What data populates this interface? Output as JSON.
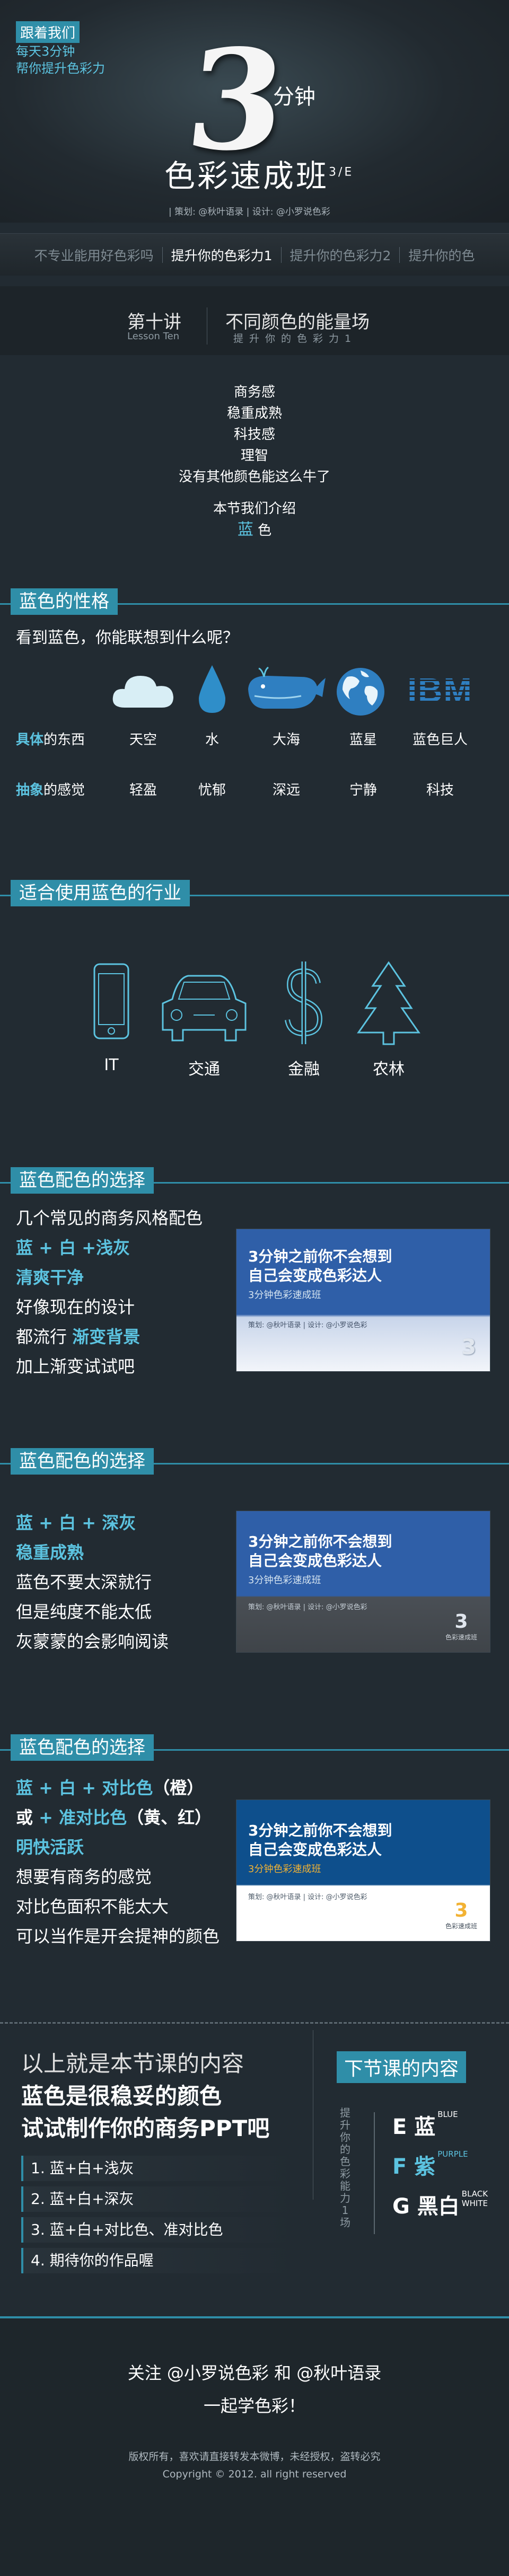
{
  "hero": {
    "follow": "跟着我们",
    "tag1": "每天3分钟",
    "tag2": "帮你提升色彩力",
    "big3": "3",
    "minute": "分钟",
    "title": "色彩速成班",
    "title_sup": "3/E",
    "credits": "| 策划: @秋叶语录    | 设计: @小罗说色彩"
  },
  "nav": {
    "items": [
      "不专业能用好色彩吗",
      "提升你的色彩力1",
      "提升你的色彩力2",
      "提升你的色"
    ],
    "active_index": 1
  },
  "lesson": {
    "cn": "第十讲",
    "en": "Lesson Ten",
    "topic": "不同颜色的能量场",
    "sub": "提升你的色彩力1"
  },
  "intro": {
    "lines": [
      "商务感",
      "稳重成熟",
      "科技感",
      "理智",
      "没有其他颜色能这么牛了"
    ],
    "present": "本节我们介绍",
    "color_word": "蓝",
    "color_suffix": "色"
  },
  "sec1": {
    "title": "蓝色的性格",
    "question": "看到蓝色，你能联想到什么呢？",
    "concrete_hl": "具体",
    "concrete_rest": "的东西",
    "abstract_hl": "抽象",
    "abstract_rest": "的感觉",
    "icons": [
      {
        "icon": "cloud-icon",
        "concrete": "天空",
        "abstract": "轻盈"
      },
      {
        "icon": "water-drop-icon",
        "concrete": "水",
        "abstract": "忧郁"
      },
      {
        "icon": "whale-icon",
        "concrete": "大海",
        "abstract": "深远"
      },
      {
        "icon": "globe-icon",
        "concrete": "蓝星",
        "abstract": "宁静"
      },
      {
        "icon": "ibm-logo-icon",
        "concrete": "蓝色巨人",
        "abstract": "科技"
      }
    ],
    "ibm_text": "IBM"
  },
  "sec2": {
    "title": "适合使用蓝色的行业",
    "industries": [
      "IT",
      "交通",
      "金融",
      "农林"
    ]
  },
  "sec3": {
    "title": "蓝色配色的选择",
    "lines": [
      "几个常见的商务风格配色",
      "蓝 + 白 +浅灰",
      "清爽干净",
      "好像现在的设计",
      "都流行 ",
      "渐变背景",
      "加上渐变试试吧"
    ],
    "slide_title1": "3分钟之前你不会想到",
    "slide_title2": "自己会变成色彩达人",
    "slide_sub": "3分钟色彩速成班",
    "slide_credit": "策划: @秋叶语录 | 设计: @小罗说色彩"
  },
  "sec4": {
    "title": "蓝色配色的选择",
    "lines": [
      "蓝 + 白 + 深灰",
      "稳重成熟",
      "蓝色不要太深就行",
      "但是纯度不能太低",
      "灰蒙蒙的会影响阅读"
    ],
    "slide_title1": "3分钟之前你不会想到",
    "slide_title2": "自己会变成色彩达人",
    "slide_sub": "3分钟色彩速成班",
    "slide_credit": "策划: @秋叶语录 | 设计: @小罗说色彩",
    "slide_badge": "色彩速成班"
  },
  "sec5": {
    "title": "蓝色配色的选择",
    "line1_hl": "蓝 + 白 + 对比色",
    "line1_rest": "（橙）",
    "line2_a": "或",
    "line2_hl": " + 准对比色",
    "line2_rest": "（黄、红）",
    "line3": "明快活跃",
    "lines": [
      "想要有商务的感觉",
      "对比色面积不能太大",
      "可以当作是开会提神的颜色"
    ],
    "slide_title1": "3分钟之前你不会想到",
    "slide_title2": "自己会变成色彩达人",
    "slide_sub": "3分钟色彩速成班",
    "slide_credit": "策划: @秋叶语录 | 设计: @小罗说色彩",
    "slide_badge": "色彩速成班"
  },
  "summary": {
    "t1": "以上就是本节课的内容",
    "t2": "蓝色是很稳妥的颜色",
    "t3": "试试制作你的商务PPT吧",
    "items": [
      "1. 蓝+白+浅灰",
      "2. 蓝+白+深灰",
      "3. 蓝+白+对比色、准对比色",
      "4. 期待你的作品喔"
    ]
  },
  "next": {
    "title": "下节课的内容",
    "vertical": "提升你的色彩能力1场",
    "items": [
      {
        "letter": "E",
        "cn": "蓝",
        "en": "BLUE",
        "color": "#ffffff"
      },
      {
        "letter": "F",
        "cn": "紫",
        "en": "PURPLE",
        "color": "#5cc3e0"
      },
      {
        "letter": "G",
        "cn": "黑白",
        "en": "BLACK WHITE",
        "color": "#ffffff"
      }
    ]
  },
  "footer": {
    "line1": "关注 @小罗说色彩 和 @秋叶语录",
    "line2": "一起学色彩！",
    "line3": "版权所有，喜欢请直接转发本微博，未经授权，盗转必究",
    "line4": "Copyright © 2012. all right reserved"
  },
  "colors": {
    "accent": "#2f8ea8",
    "accent_light": "#5cc3e0",
    "background": "#222b32"
  }
}
